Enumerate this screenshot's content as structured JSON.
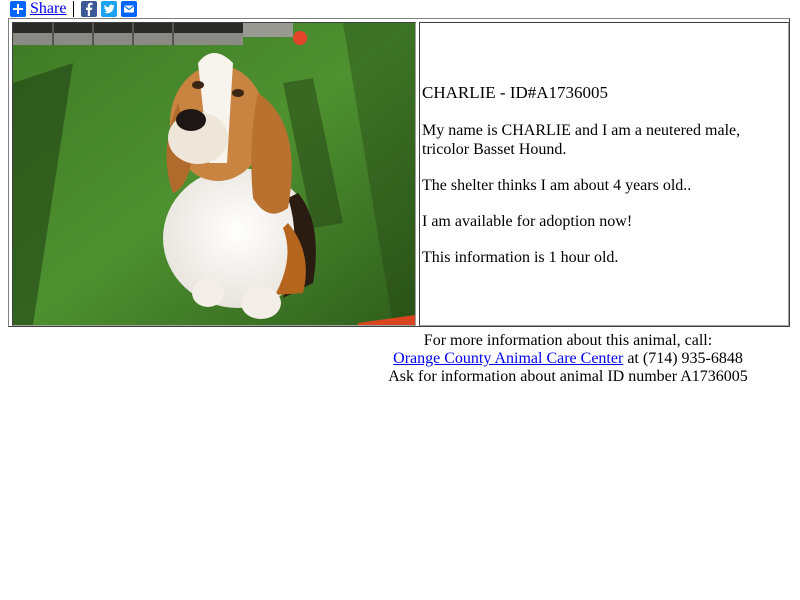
{
  "share": {
    "label": "Share",
    "icons": [
      "plus-icon",
      "facebook-icon",
      "twitter-icon",
      "email-icon"
    ]
  },
  "animal": {
    "heading": "CHARLIE - ID#A1736005",
    "description": "My name is CHARLIE and I am a neutered male, tricolor Basset Hound.",
    "age": "The shelter thinks I am about 4 years old..",
    "availability": "I am available for adoption now!",
    "freshness": "This information is 1 hour old.",
    "photo_subject": "tricolor Basset Hound sitting on grass"
  },
  "contact": {
    "intro": "For more information about this animal, call:",
    "center_link": "Orange County Animal Care Center",
    "phone": "at (714) 935-6848",
    "ask": "Ask for information about animal ID number A1736005"
  },
  "colors": {
    "link": "#0000ee",
    "share_blue": "#0166ff",
    "facebook": "#3b5998",
    "twitter": "#1da1f2"
  }
}
